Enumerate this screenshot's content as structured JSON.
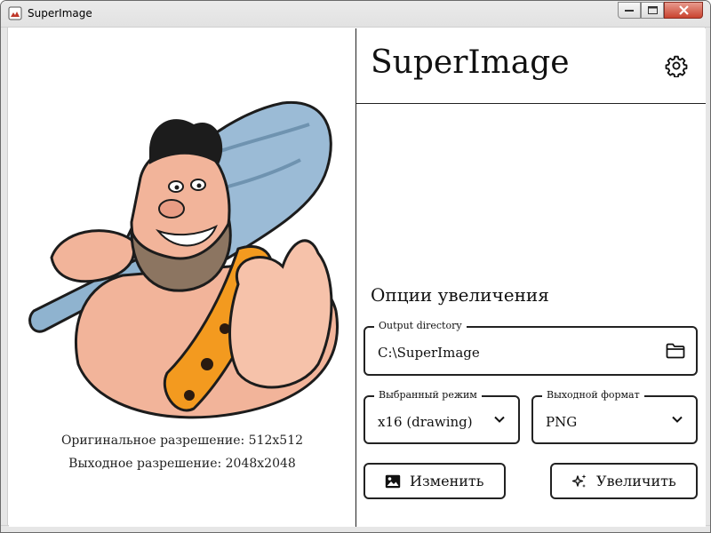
{
  "window": {
    "title": "SuperImage"
  },
  "header": {
    "app_title": "SuperImage"
  },
  "preview": {
    "original_resolution": "Оригинальное разрешение: 512x512",
    "output_resolution": "Выходное разрешение: 2048x2048"
  },
  "options": {
    "section_title": "Опции увеличения",
    "output_directory": {
      "label": "Output directory",
      "value": "C:\\SuperImage"
    },
    "mode": {
      "label": "Выбранный режим",
      "value": "x16 (drawing)"
    },
    "format": {
      "label": "Выходной формат",
      "value": "PNG"
    }
  },
  "buttons": {
    "edit_label": "Изменить",
    "upscale_label": "Увеличить"
  },
  "icons": {
    "app": "app-icon",
    "settings": "gear-icon",
    "folder": "folder-icon",
    "chevron": "chevron-down-icon",
    "image": "image-icon",
    "sparkles": "sparkles-icon"
  },
  "colors": {
    "border": "#222222",
    "close_button": "#c9432f"
  }
}
